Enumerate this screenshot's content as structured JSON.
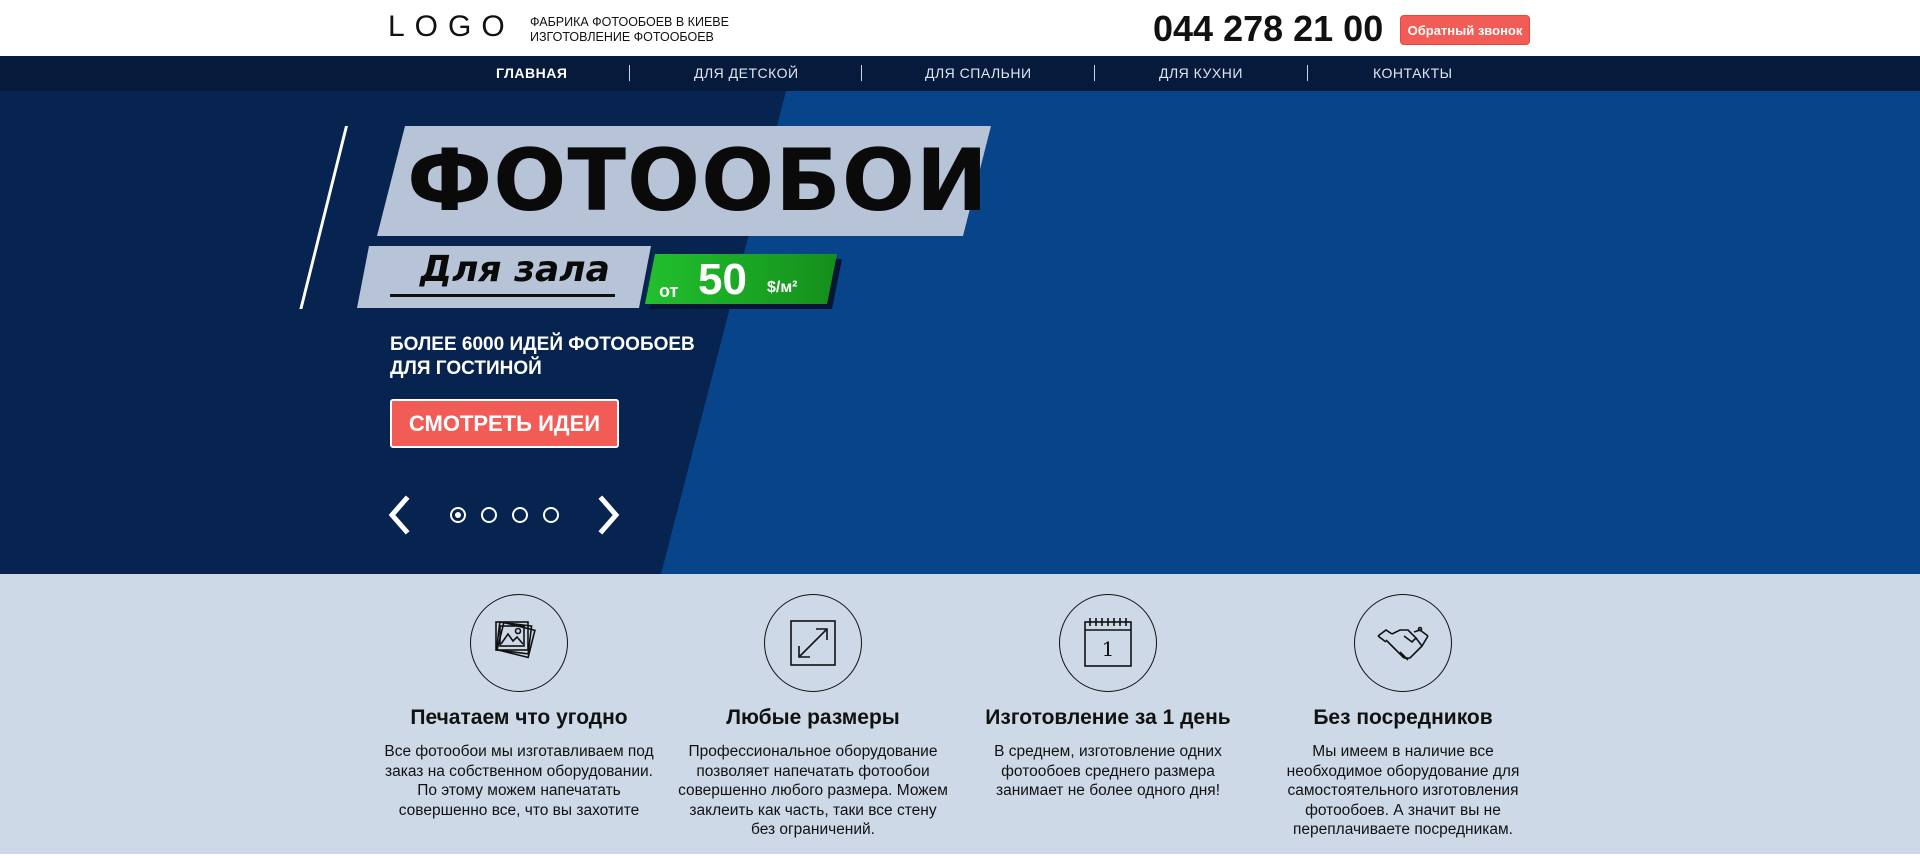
{
  "header": {
    "logo": "LOGO",
    "tagline_line1": "ФАБРИКА ФОТООБОЕВ В КИЕВЕ",
    "tagline_line2": "ИЗГОТОВЛЕНИЕ ФОТООБОЕВ",
    "phone": "044 278 21 00",
    "callback_label": "Обратный звонок"
  },
  "nav": {
    "items": [
      {
        "label": "ГЛАВНАЯ",
        "active": true
      },
      {
        "label": "ДЛЯ ДЕТСКОЙ",
        "active": false
      },
      {
        "label": "ДЛЯ СПАЛЬНИ",
        "active": false
      },
      {
        "label": "ДЛЯ КУХНИ",
        "active": false
      },
      {
        "label": "КОНТАКТЫ",
        "active": false
      }
    ]
  },
  "hero": {
    "title": "ФОТООБОИ",
    "subtitle": "Для зала",
    "price_from": "от",
    "price_value": "50",
    "price_unit": "$/м²",
    "desc_line1": "БОЛЕЕ 6000 ИДЕЙ ФОТООБОЕВ",
    "desc_line2": "ДЛЯ ГОСТИНОЙ",
    "cta_label": "СМОТРЕТЬ ИДЕИ",
    "slides_total": 4,
    "active_slide": 1
  },
  "features": [
    {
      "icon": "photos-icon",
      "title": "Печатаем что угодно",
      "text": "Все фотообои мы изготавливаем под заказ на собственном оборудовании. По этому можем напечатать совершенно все, что вы захотите"
    },
    {
      "icon": "resize-icon",
      "title": "Любые размеры",
      "text": "Профессиональное оборудование позволяет напечатать фотообои совершенно любого размера. Можем заклеить как часть, таки все стену без ограничений."
    },
    {
      "icon": "calendar-icon",
      "title": "Изготовление за 1 день",
      "text": "В среднем, изготовление одних фотообоев среднего размера занимает не более одного дня!",
      "calendar_number": "1"
    },
    {
      "icon": "handshake-icon",
      "title": "Без посредников",
      "text": "Мы имеем в наличие все необходимое оборудование для самостоятельного изготовления фотообоев. А значит вы не переплачиваете посредникам."
    }
  ],
  "colors": {
    "accent_red": "#f25c56",
    "nav_bg": "#061a3b",
    "hero_dark": "#06244f",
    "hero_blue": "#08448a",
    "band_grey": "#b7c4d8",
    "price_green": "#1fae29",
    "features_bg": "#cdd9e6"
  }
}
